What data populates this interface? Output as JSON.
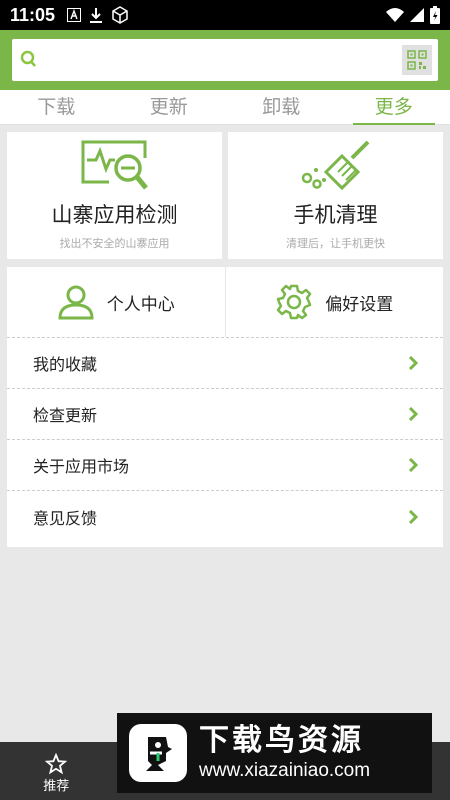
{
  "status_bar": {
    "time": "11:05"
  },
  "search": {
    "placeholder": ""
  },
  "tabs": [
    {
      "label": "下载"
    },
    {
      "label": "更新"
    },
    {
      "label": "卸载"
    },
    {
      "label": "更多"
    }
  ],
  "cards": [
    {
      "title": "山寨应用检测",
      "subtitle": "找出不安全的山寨应用"
    },
    {
      "title": "手机清理",
      "subtitle": "清理后，让手机更快"
    }
  ],
  "quick_actions": [
    {
      "label": "个人中心"
    },
    {
      "label": "偏好设置"
    }
  ],
  "menu": [
    {
      "label": "我的收藏"
    },
    {
      "label": "检查更新"
    },
    {
      "label": "关于应用市场"
    },
    {
      "label": "意见反馈"
    }
  ],
  "bottom_nav": [
    {
      "label": "推荐"
    },
    {
      "label": ""
    },
    {
      "label": ""
    },
    {
      "label": ""
    }
  ],
  "watermark": {
    "title": "下载鸟资源",
    "url": "www.xiazainiao.com"
  },
  "colors": {
    "accent": "#7ab648",
    "status_bar": "#000000",
    "bottom_nav": "#333333"
  }
}
